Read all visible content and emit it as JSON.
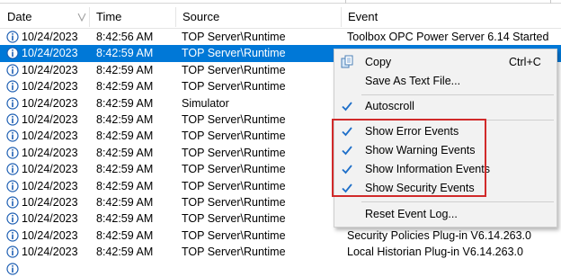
{
  "columns": {
    "date": "Date",
    "time": "Time",
    "source": "Source",
    "event": "Event"
  },
  "rows": [
    {
      "date": "10/24/2023",
      "time": "8:42:56 AM",
      "source": "TOP Server\\Runtime",
      "event": "Toolbox OPC Power Server 6.14 Started"
    },
    {
      "date": "10/24/2023",
      "time": "8:42:59 AM",
      "source": "TOP Server\\Runtime",
      "event": ""
    },
    {
      "date": "10/24/2023",
      "time": "8:42:59 AM",
      "source": "TOP Server\\Runtime",
      "event": ""
    },
    {
      "date": "10/24/2023",
      "time": "8:42:59 AM",
      "source": "TOP Server\\Runtime",
      "event": ""
    },
    {
      "date": "10/24/2023",
      "time": "8:42:59 AM",
      "source": "Simulator",
      "event": ""
    },
    {
      "date": "10/24/2023",
      "time": "8:42:59 AM",
      "source": "TOP Server\\Runtime",
      "event": ""
    },
    {
      "date": "10/24/2023",
      "time": "8:42:59 AM",
      "source": "TOP Server\\Runtime",
      "event": ""
    },
    {
      "date": "10/24/2023",
      "time": "8:42:59 AM",
      "source": "TOP Server\\Runtime",
      "event": ""
    },
    {
      "date": "10/24/2023",
      "time": "8:42:59 AM",
      "source": "TOP Server\\Runtime",
      "event": ""
    },
    {
      "date": "10/24/2023",
      "time": "8:42:59 AM",
      "source": "TOP Server\\Runtime",
      "event": ""
    },
    {
      "date": "10/24/2023",
      "time": "8:42:59 AM",
      "source": "TOP Server\\Runtime",
      "event": ""
    },
    {
      "date": "10/24/2023",
      "time": "8:42:59 AM",
      "source": "TOP Server\\Runtime",
      "event": ""
    },
    {
      "date": "10/24/2023",
      "time": "8:42:59 AM",
      "source": "TOP Server\\Runtime",
      "event": "Security Policies Plug-in V6.14.263.0"
    },
    {
      "date": "10/24/2023",
      "time": "8:42:59 AM",
      "source": "TOP Server\\Runtime",
      "event": "Local Historian Plug-in V6.14.263.0"
    },
    {
      "date": "",
      "time": "",
      "source": "",
      "event": ""
    }
  ],
  "selected_row": 1,
  "context_menu": {
    "copy": "Copy",
    "copy_shortcut": "Ctrl+C",
    "save_as_text": "Save As Text File...",
    "autoscroll": "Autoscroll",
    "show_error": "Show Error Events",
    "show_warning": "Show Warning Events",
    "show_information": "Show Information Events",
    "show_security": "Show Security Events",
    "reset_log": "Reset Event Log..."
  },
  "colors": {
    "selection": "#0078d7",
    "highlight_box": "#d12a2a",
    "info_icon": "#1e5fb3",
    "check": "#1e6fc9"
  },
  "icons": {
    "row": "info-icon",
    "copy": "copy-icon",
    "check": "checkmark-icon",
    "sort": "sort-icon"
  }
}
